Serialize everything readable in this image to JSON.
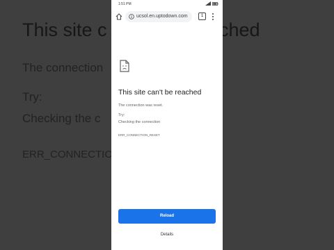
{
  "background": {
    "title_left": "This site c",
    "title_right": "reached",
    "connection": "The connection",
    "try": "Try:",
    "checking": "Checking the c",
    "error_code": "ERR_CONNECTION"
  },
  "status_bar": {
    "time": "1:51 PM"
  },
  "toolbar": {
    "url": "ucsol.en.uptodown.com",
    "tab_count": "1"
  },
  "error_page": {
    "title": "This site can't be reached",
    "message": "The connection was reset.",
    "try_label": "Try:",
    "suggestion": "Checking the connection",
    "error_code": "ERR_CONNECTION_RESET",
    "reload_label": "Reload",
    "details_label": "Details"
  },
  "colors": {
    "accent": "#1a73e8",
    "page_background": "#ffffff",
    "backdrop": "#3f3f3f"
  }
}
